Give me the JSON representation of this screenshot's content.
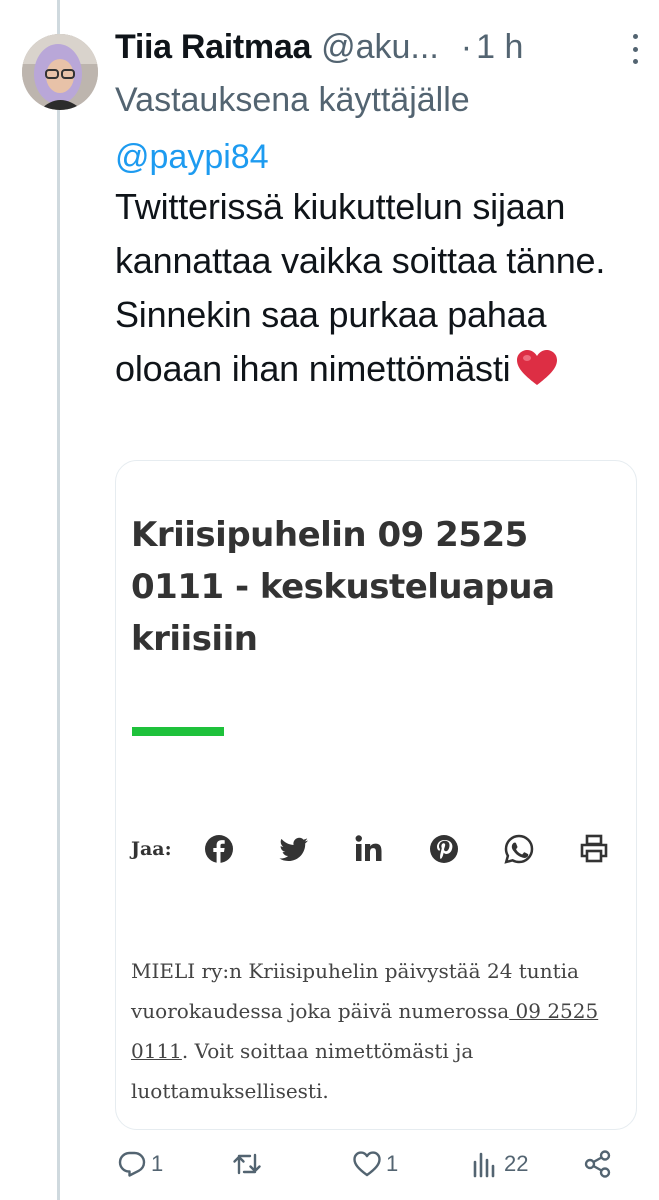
{
  "tweet": {
    "author_name": "Tiia Raitmaa",
    "handle": "@aku...",
    "dot": "·",
    "time": "1 h",
    "reply_prefix": "Vastauksena käyttäjälle",
    "reply_mention": "@paypi84",
    "text": "Twitterissä kiukuttelun sijaan kannattaa vaikka soittaa tänne. Sinnekin saa purkaa pahaa oloaan ihan nimettömästi"
  },
  "card": {
    "title": "Kriisipuhelin 09 2525 0111 - keskusteluapua kriisiin",
    "share_label": "Jaa:",
    "share_icons": [
      "facebook-icon",
      "twitter-icon",
      "linkedin-icon",
      "pinterest-icon",
      "whatsapp-icon",
      "print-icon"
    ],
    "body_before": "MIELI ry:n Kriisipuhelin päivystää 24 tuntia vuorokaudessa joka päivä numerossa",
    "body_link": " 09 2525 0111",
    "body_after": ". Voit soittaa nimettömästi ja luottamuksellisesti.",
    "accent_color": "#1ec13b"
  },
  "actions": {
    "replies": "1",
    "retweets": "",
    "likes": "1",
    "views": "22"
  }
}
